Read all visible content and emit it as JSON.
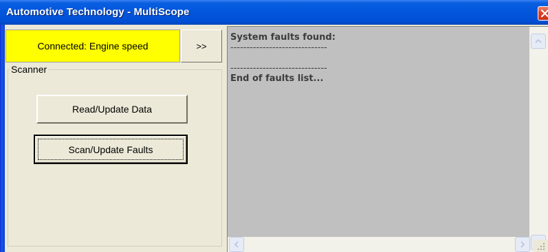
{
  "window": {
    "title": "Automotive Technology - MultiScope"
  },
  "status": {
    "connection_text": "Connected: Engine speed",
    "highlight_color": "#ffff00",
    "more_button_label": ">>"
  },
  "scanner": {
    "group_label": "Scanner",
    "read_button_label": "Read/Update Data",
    "scan_button_label": "Scan/Update Faults"
  },
  "faults": {
    "header": "System faults found:",
    "separator_top": "------------------------------",
    "separator_bottom": "------------------------------",
    "footer": "End of faults list..."
  },
  "icons": {
    "close": "close-icon",
    "scroll_up": "chevron-up-icon",
    "scroll_down": "chevron-down-icon",
    "scroll_left": "chevron-left-icon",
    "scroll_right": "chevron-right-icon",
    "resize": "resize-grip-icon"
  }
}
